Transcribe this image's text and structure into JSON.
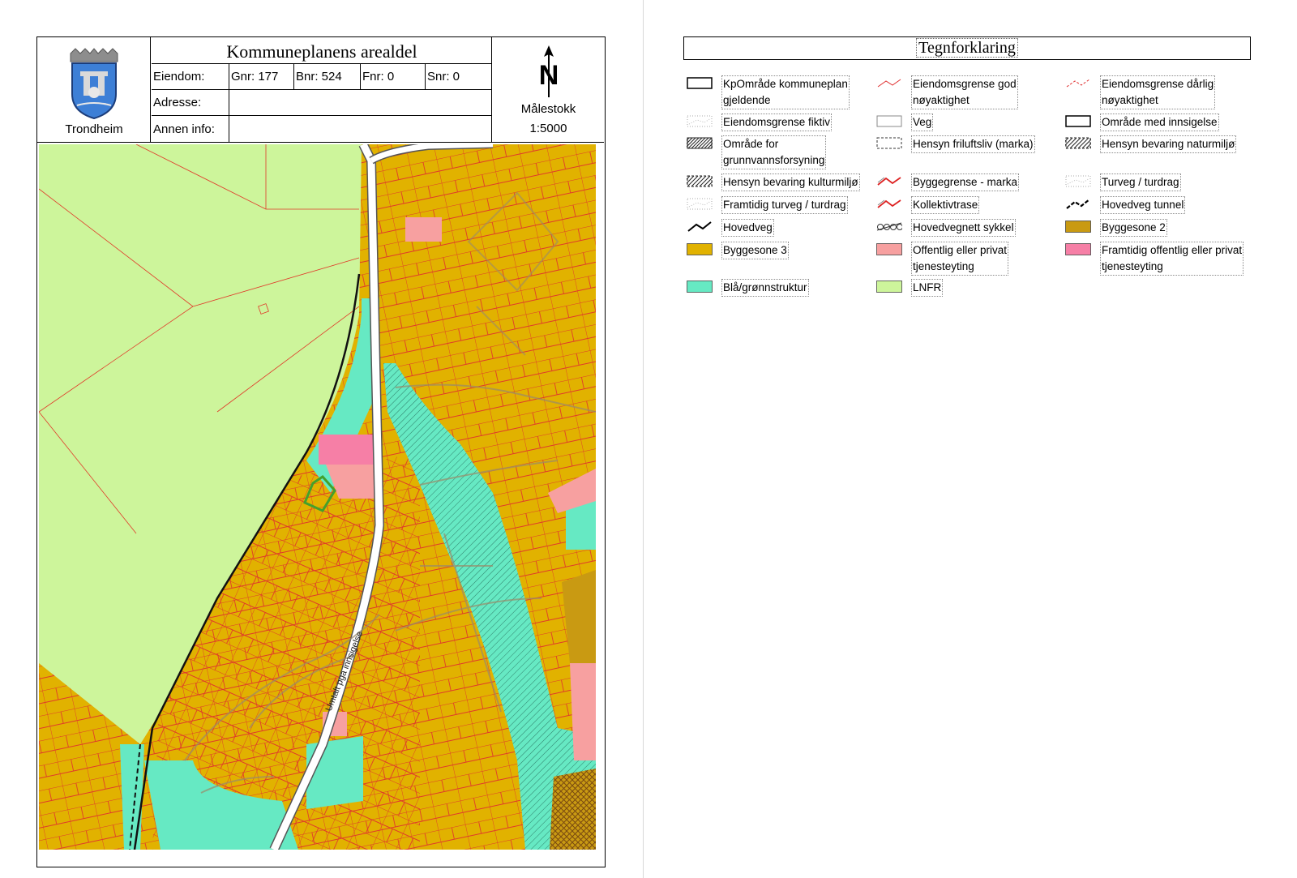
{
  "header": {
    "municipality": "Trondheim",
    "title": "Kommuneplanens arealdel",
    "property": {
      "label": "Eiendom:",
      "gnr": "Gnr: 177",
      "bnr": "Bnr: 524",
      "fnr": "Fnr: 0",
      "snr": "Snr: 0"
    },
    "address_label": "Adresse:",
    "address_value": "",
    "other_info_label": "Annen info:",
    "other_info_value": "",
    "north_letter": "N",
    "scale_label": "Målestokk",
    "scale_value": "1:5000"
  },
  "map": {
    "road_label": "Umtalt pga innsigelse",
    "colors": {
      "lnfr": "#cdf59b",
      "byggesone3": "#e1b200",
      "byggesone2": "#c99a12",
      "blagronn": "#66e9c3",
      "offentlig": "#f7a0a0",
      "framtidig_offentlig": "#f67fa6",
      "property_line": "#e03030",
      "road": "#ffffff",
      "highlight": "#44a02c"
    }
  },
  "legend": {
    "title": "Tegnforklaring",
    "items": [
      {
        "label": "KpOmråde kommuneplan\ngjeldende",
        "symbol": "box-solid"
      },
      {
        "label": "Eiendomsgrense god\nnøyaktighet",
        "symbol": "red-line"
      },
      {
        "label": "Eiendomsgrense dårlig\nnøyaktighet",
        "symbol": "red-dash"
      },
      {
        "label": "Eiendomsgrense fiktiv",
        "symbol": "grey-dotted"
      },
      {
        "label": "Veg",
        "symbol": "box-thin"
      },
      {
        "label": "Område med innsigelse",
        "symbol": "box-solid"
      },
      {
        "label": "Område for\ngrunnvannsforsyning",
        "symbol": "hatch-dense"
      },
      {
        "label": "Hensyn friluftsliv (marka)",
        "symbol": "box-dashed"
      },
      {
        "label": "Hensyn bevaring naturmiljø",
        "symbol": "hatch"
      },
      {
        "label": "Hensyn bevaring kulturmiljø",
        "symbol": "hatch"
      },
      {
        "label": "Byggegrense - marka",
        "symbol": "red-zigzag"
      },
      {
        "label": "Turveg / turdrag",
        "symbol": "grey-dotted"
      },
      {
        "label": "Framtidig turveg / turdrag",
        "symbol": "grey-dotted"
      },
      {
        "label": "Kollektivtrase",
        "symbol": "red-zigzag"
      },
      {
        "label": "Hovedveg tunnel",
        "symbol": "black-dashed"
      },
      {
        "label": "Hovedveg",
        "symbol": "black-line"
      },
      {
        "label": "Hovedvegnett sykkel",
        "symbol": "bike"
      },
      {
        "label": "Byggesone 2",
        "symbol": "fill",
        "color": "#c99a12"
      },
      {
        "label": "Byggesone 3",
        "symbol": "fill",
        "color": "#e1b200"
      },
      {
        "label": "Offentlig eller privat\ntjenesteyting",
        "symbol": "fill",
        "color": "#f7a0a0"
      },
      {
        "label": "Framtidig offentlig eller privat\ntjenesteyting",
        "symbol": "fill",
        "color": "#f67fa6"
      },
      {
        "label": "Blå/grønnstruktur",
        "symbol": "fill",
        "color": "#66e9c3"
      },
      {
        "label": "LNFR",
        "symbol": "fill",
        "color": "#cdf59b"
      }
    ]
  }
}
